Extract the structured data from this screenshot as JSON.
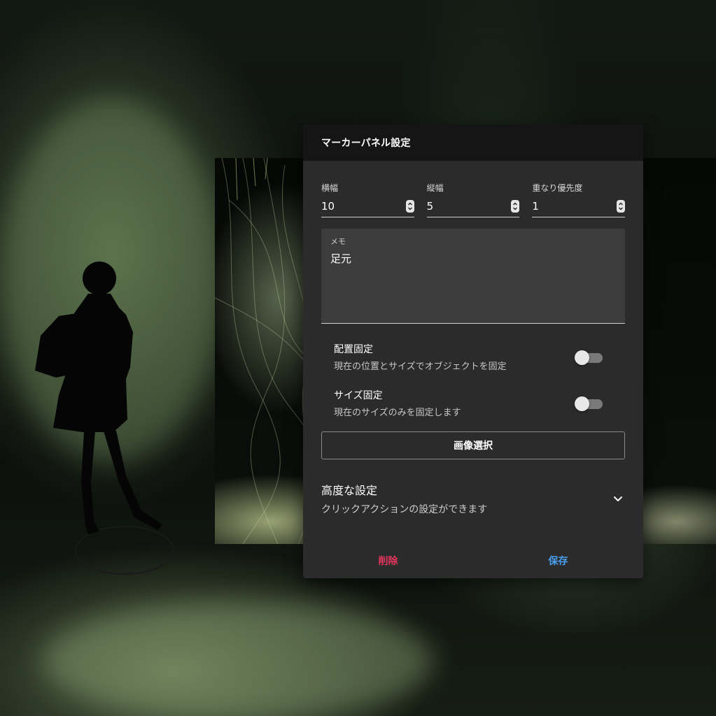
{
  "dialog": {
    "title": "マーカーパネル設定",
    "fields": [
      {
        "label": "横幅",
        "value": "10"
      },
      {
        "label": "縦幅",
        "value": "5"
      },
      {
        "label": "重なり優先度",
        "value": "1"
      }
    ],
    "memo": {
      "label": "メモ",
      "value": "足元"
    },
    "toggles": [
      {
        "title": "配置固定",
        "description": "現在の位置とサイズでオブジェクトを固定",
        "on": false
      },
      {
        "title": "サイズ固定",
        "description": "現在のサイズのみを固定します",
        "on": false
      }
    ],
    "image_select_label": "画像選択",
    "advanced": {
      "title": "高度な設定",
      "description": "クリックアクションの設定ができます"
    },
    "footer": {
      "delete_label": "削除",
      "save_label": "保存"
    }
  },
  "colors": {
    "delete": "#e5365e",
    "save": "#4a9ff0",
    "dialog_bg": "#2b2b2b",
    "header_bg": "#151515"
  },
  "icons": {
    "stepper": "up-down-stepper-icon",
    "chevron": "chevron-down-icon"
  }
}
